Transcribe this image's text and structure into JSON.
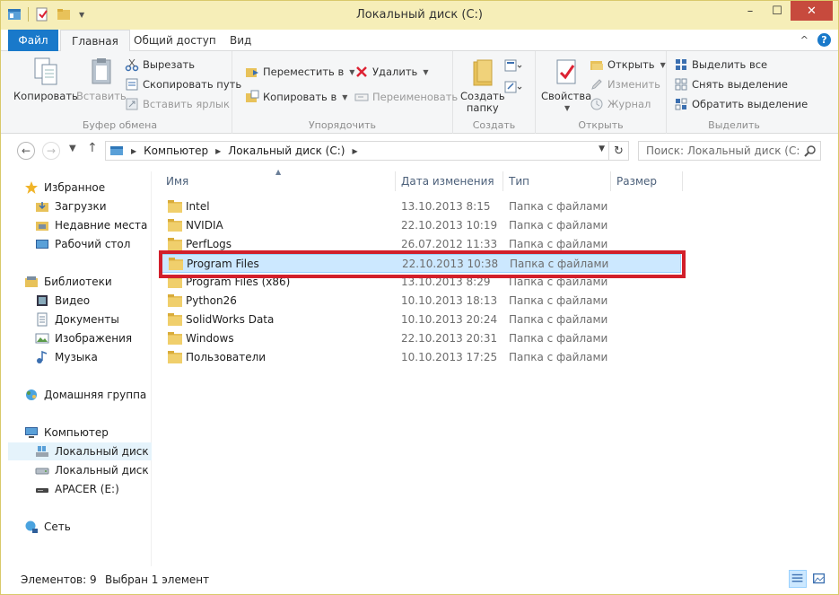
{
  "window": {
    "title": "Локальный диск (C:)",
    "minimize": "–",
    "maximize": "☐",
    "close": "✕"
  },
  "ribbon_tabs": {
    "file": "Файл",
    "home": "Главная",
    "share": "Общий доступ",
    "view": "Вид",
    "help": "?",
    "collapse": "^"
  },
  "clipboard": {
    "copy": "Копировать",
    "paste": "Вставить",
    "cut": "Вырезать",
    "copy_path": "Скопировать путь",
    "paste_shortcut": "Вставить ярлык",
    "label": "Буфер обмена"
  },
  "organize": {
    "move_to": "Переместить в",
    "copy_to": "Копировать в",
    "delete": "Удалить",
    "rename": "Переименовать",
    "label": "Упорядочить"
  },
  "new": {
    "new_folder_line1": "Создать",
    "new_folder_line2": "папку",
    "label": "Создать"
  },
  "open": {
    "properties": "Свойства",
    "open": "Открыть",
    "edit": "Изменить",
    "history": "Журнал",
    "label": "Открыть"
  },
  "select": {
    "select_all": "Выделить все",
    "select_none": "Снять выделение",
    "invert": "Обратить выделение",
    "label": "Выделить"
  },
  "address": {
    "crumbs": [
      "Компьютер",
      "Локальный диск (C:)"
    ],
    "search_placeholder": "Поиск: Локальный диск (C:)"
  },
  "nav": {
    "favorites": "Избранное",
    "downloads": "Загрузки",
    "recent": "Недавние места",
    "desktop": "Рабочий стол",
    "libraries": "Библиотеки",
    "video": "Видео",
    "documents": "Документы",
    "pictures": "Изображения",
    "music": "Музыка",
    "homegroup": "Домашняя группа",
    "computer": "Компьютер",
    "disk_c": "Локальный диск (C",
    "disk_d": "Локальный диск (D",
    "apacer": "APACER (E:)",
    "network": "Сеть"
  },
  "columns": {
    "name": "Имя",
    "date": "Дата изменения",
    "type": "Тип",
    "size": "Размер"
  },
  "files": [
    {
      "name": "Intel",
      "date": "13.10.2013 8:15",
      "type": "Папка с файлами"
    },
    {
      "name": "NVIDIA",
      "date": "22.10.2013 10:19",
      "type": "Папка с файлами"
    },
    {
      "name": "PerfLogs",
      "date": "26.07.2012 11:33",
      "type": "Папка с файлами"
    },
    {
      "name": "Program Files",
      "date": "22.10.2013 10:38",
      "type": "Папка с файлами"
    },
    {
      "name": "Program Files (x86)",
      "date": "13.10.2013 8:29",
      "type": "Папка с файлами"
    },
    {
      "name": "Python26",
      "date": "10.10.2013 18:13",
      "type": "Папка с файлами"
    },
    {
      "name": "SolidWorks Data",
      "date": "10.10.2013 20:24",
      "type": "Папка с файлами"
    },
    {
      "name": "Windows",
      "date": "22.10.2013 20:31",
      "type": "Папка с файлами"
    },
    {
      "name": "Пользователи",
      "date": "10.10.2013 17:25",
      "type": "Папка с файлами"
    }
  ],
  "status": {
    "count": "Элементов: 9",
    "selected": "Выбран 1 элемент"
  },
  "colors": {
    "accent": "#1979ca",
    "title_bg": "#f6eeb8",
    "selection": "#cce8ff",
    "highlight_frame": "#d21f2b",
    "folder": "#e8c25a"
  }
}
